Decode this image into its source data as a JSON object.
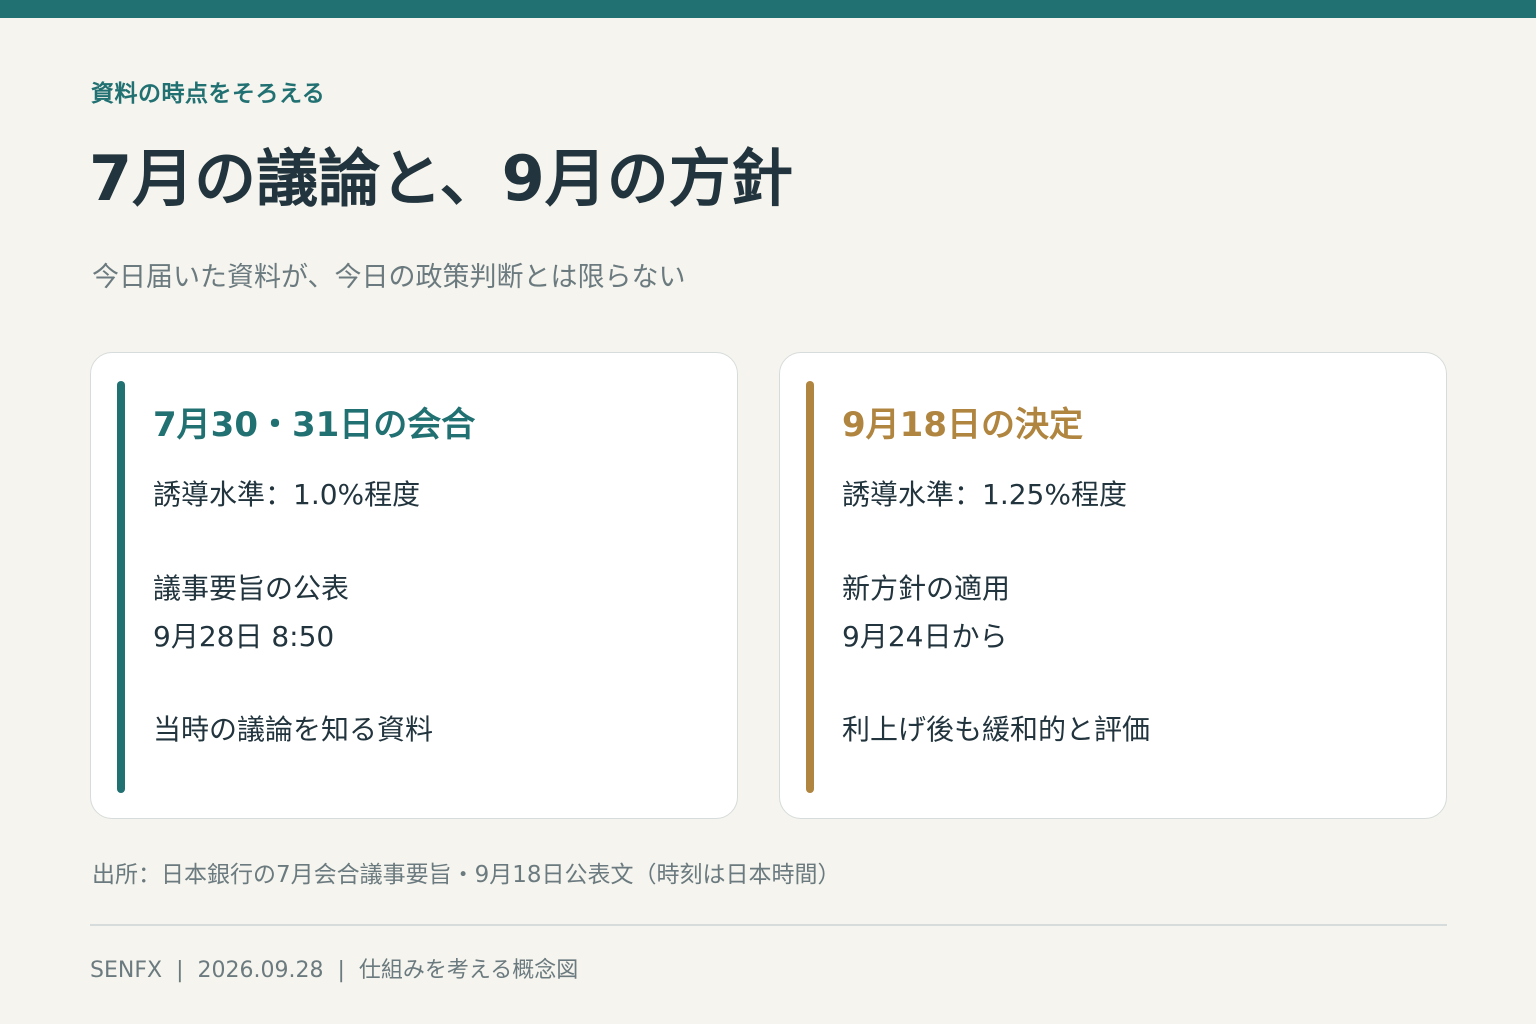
{
  "header": {
    "eyebrow": "資料の時点をそろえる",
    "title": "7月の議論と、9月の方針",
    "subtitle": "今日届いた資料が、今日の政策判断とは限らない"
  },
  "cards": [
    {
      "title": "7月30・31日の会合",
      "rate": "誘導水準：1.0%程度",
      "item_label": "議事要旨の公表",
      "item_value": "9月28日 8:50",
      "note": "当時の議論を知る資料"
    },
    {
      "title": "9月18日の決定",
      "rate": "誘導水準：1.25%程度",
      "item_label": "新方針の適用",
      "item_value": "9月24日から",
      "note": "利上げ後も緩和的と評価"
    }
  ],
  "source": "出所：日本銀行の7月会合議事要旨・9月18日公表文（時刻は日本時間）",
  "footer": {
    "brand": "SENFX",
    "date": "2026.09.28",
    "caption": "仕組みを考える概念図",
    "separator": "|"
  },
  "colors": {
    "accent_teal": "#217072",
    "accent_gold": "#b0853f",
    "background": "#f5f4ee",
    "text": "#22343d",
    "muted": "#6b7a7f"
  }
}
